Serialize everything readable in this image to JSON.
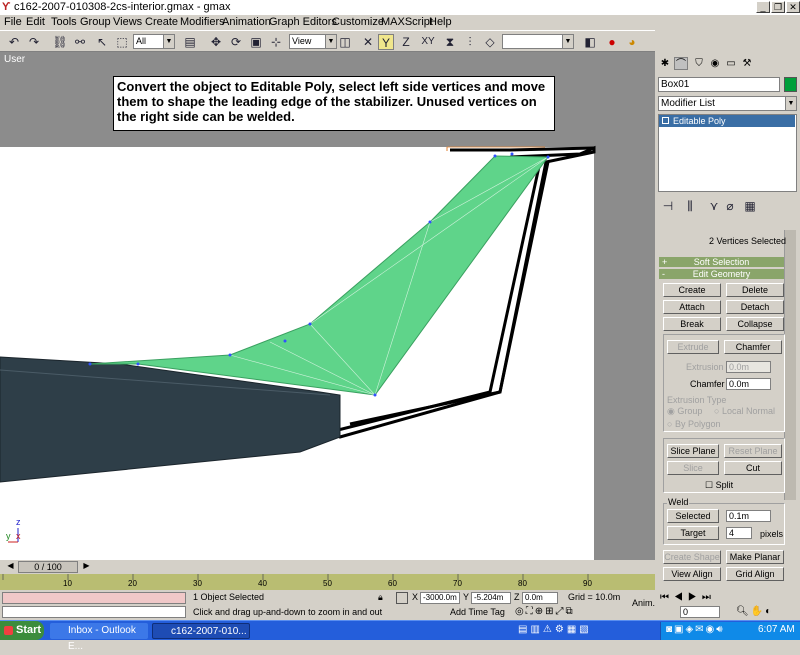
{
  "window": {
    "title": "c162-2007-010308-2cs-interior.gmax - gmax",
    "min": "_",
    "max": "❐",
    "close": "✕"
  },
  "menu": [
    "File",
    "Edit",
    "Tools",
    "Group",
    "Views",
    "Create",
    "Modifiers",
    "Animation",
    "Graph Editors",
    "Customize",
    "MAXScript",
    "Help"
  ],
  "toolbar": {
    "selection_filter": "All",
    "ref_coord": "View",
    "axis_y": "Y",
    "axis_z": "Z",
    "axis_xy": "XY"
  },
  "viewport": {
    "label": "User",
    "instruction": "Convert the object to Editable Poly, select left side vertices and move them to shape the leading edge of the stabilizer.  Unused vertices on the right side can be welded.",
    "axis_z": "z",
    "axis_y": "y",
    "axis_x": "x"
  },
  "command_panel": {
    "object_name": "Box01",
    "object_color": "#009f3a",
    "modifier_list": "Modifier List",
    "stack_item": "Editable Poly",
    "selection_status": "2 Vertices Selected",
    "soft_selection": "Soft Selection",
    "edit_geometry": "Edit Geometry",
    "plus": "+",
    "minus": "-",
    "buttons": {
      "create": "Create",
      "delete": "Delete",
      "attach": "Attach",
      "detach": "Detach",
      "break": "Break",
      "collapse": "Collapse",
      "extrude": "Extrude",
      "chamfer": "Chamfer",
      "slice_plane": "Slice Plane",
      "reset_plane": "Reset Plane",
      "slice": "Slice",
      "cut": "Cut",
      "selected": "Selected",
      "target": "Target",
      "create_shape": "Create Shape",
      "make_planar": "Make Planar",
      "view_align": "View Align",
      "grid_align": "Grid Align"
    },
    "extrusion_label": "Extrusion",
    "extrusion_value": "0.0m",
    "chamfer_label": "Chamfer",
    "chamfer_value": "0.0m",
    "extrusion_type": "Extrusion Type",
    "group": "Group",
    "local_normal": "Local Normal",
    "by_polygon": "By Polygon",
    "split": "Split",
    "weld": "Weld",
    "weld_threshold": "0.1m",
    "target_pixels": "4",
    "pixels": "pixels"
  },
  "timeline": {
    "frame": "0 / 100",
    "ticks": [
      "10",
      "20",
      "30",
      "40",
      "50",
      "60",
      "70",
      "80",
      "90"
    ]
  },
  "status": {
    "selected": "1 Object Selected",
    "prompt": "Click and drag up-and-down to zoom in and out",
    "x_label": "X",
    "x_value": "-3000.0m",
    "y_label": "Y",
    "y_value": "-5.204m",
    "z_label": "Z",
    "z_value": "0.0m",
    "grid": "Grid = 10.0m",
    "time_tag": "Add Time Tag",
    "anim": "Anim.",
    "frame_value": "0"
  },
  "taskbar": {
    "start": "Start",
    "task1": "Inbox - Outlook E...",
    "task2": "c162-2007-010...",
    "clock": "6:07 AM"
  }
}
